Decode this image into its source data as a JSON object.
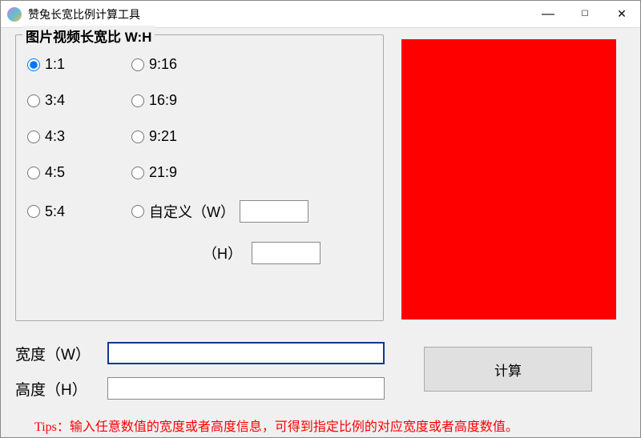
{
  "window": {
    "title": "赞兔长宽比例计算工具",
    "minimize_label": "—",
    "maximize_label": "☐",
    "close_label": "✕"
  },
  "ratio_group": {
    "legend": "图片视频长宽比 W:H",
    "options_left": [
      "1:1",
      "3:4",
      "4:3",
      "4:5",
      "5:4"
    ],
    "options_right": [
      "9:16",
      "16:9",
      "9:21",
      "21:9"
    ],
    "custom_label": "自定义（W）",
    "custom_h_label": "（H）",
    "custom_w_value": "",
    "custom_h_value": "",
    "selected": "1:1"
  },
  "inputs": {
    "width_label": "宽度（W）",
    "width_value": "",
    "height_label": "高度（H）",
    "height_value": ""
  },
  "calc_button_label": "计算",
  "tips_text": "Tips：输入任意数值的宽度或者高度信息，可得到指定比例的对应宽度或者高度数值。",
  "preview_color": "#ff0000"
}
